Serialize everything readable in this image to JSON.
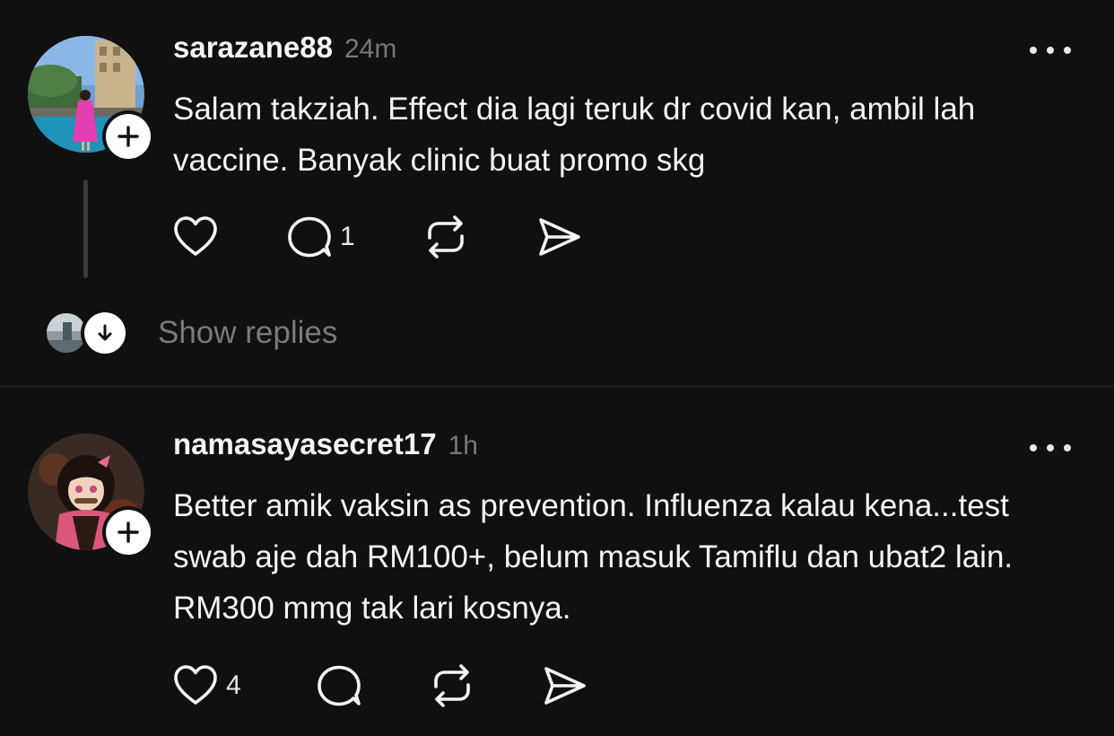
{
  "posts": [
    {
      "username": "sarazane88",
      "timestamp": "24m",
      "text": "Salam takziah. Effect dia lagi teruk dr covid kan, ambil lah vaccine. Banyak clinic buat promo skg",
      "like_count": "",
      "reply_count": "1",
      "avatar": "profile-photo-woman-pink-dress",
      "show_replies_label": "Show replies"
    },
    {
      "username": "namasayasecret17",
      "timestamp": "1h",
      "text": "Better amik vaksin as prevention. Influenza kalau kena...test swab aje dah RM100+, belum masuk Tamiflu dan ubat2 lain. RM300 mmg tak lari kosnya.",
      "like_count": "4",
      "reply_count": "",
      "avatar": "profile-photo-anime-character"
    }
  ],
  "icons": {
    "like": "heart-icon",
    "reply": "comment-bubble-icon",
    "repost": "repost-icon",
    "share": "send-icon",
    "more": "more-dots-icon",
    "follow": "plus-icon",
    "expand": "arrow-down-icon"
  },
  "colors": {
    "background": "#101010",
    "text": "#f3f5f7",
    "muted": "#777777",
    "divider": "#2a2a2a"
  }
}
